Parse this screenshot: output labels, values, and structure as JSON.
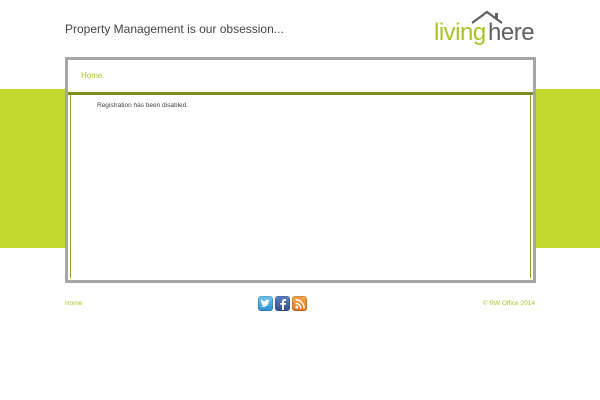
{
  "header": {
    "tagline": "Property Management is our obsession...",
    "logo": {
      "part1": "living",
      "part2": "here",
      "icon": "house-roof-icon"
    }
  },
  "nav": {
    "items": [
      {
        "label": "Home"
      }
    ]
  },
  "content": {
    "message": "Registration has been disabled."
  },
  "footer": {
    "home_label": "Home",
    "social": [
      {
        "icon": "twitter-icon"
      },
      {
        "icon": "facebook-icon"
      },
      {
        "icon": "rss-icon"
      }
    ],
    "copyright": "© RW Office 2014"
  },
  "colors": {
    "accent_green": "#c2d82e",
    "logo_green": "#a9c42a",
    "logo_gray": "#5f6060",
    "frame_gray": "#a6a6a6",
    "nav_divider": "#7a8f1e"
  }
}
